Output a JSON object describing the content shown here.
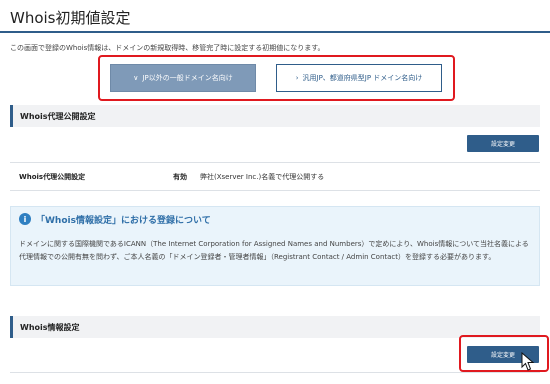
{
  "page": {
    "title": "Whois初期値設定"
  },
  "intro": "この画面で登録のWhois情報は、ドメインの新規取得時、移管完了時に設定する初期値になります。",
  "tabs": [
    {
      "label": "JP以外の一般ドメイン名向け",
      "active": true
    },
    {
      "label": "汎用JP、都道府県型JP ドメイン名向け",
      "active": false
    }
  ],
  "proxy_section": {
    "title": "Whois代理公開設定",
    "button": "設定変更",
    "row": {
      "label": "Whois代理公開設定",
      "status": "有効",
      "description": "弊社(Xserver Inc.)名義で代理公開する"
    }
  },
  "info": {
    "icon": "info-icon",
    "title": "「Whois情報設定」における登録について",
    "body": "ドメインに関する国際機関であるICANN（The Internet Corporation for Assigned Names and Numbers）で定めにより、Whois情報について当社名義による代理情報での公開有無を問わず、ご本人名義の「ドメイン登録者・管理者情報」（Registrant Contact / Admin Contact）を登録する必要があります。"
  },
  "whois_section": {
    "title": "Whois情報設定",
    "button": "設定変更"
  },
  "colors": {
    "accent": "#2f5d8a",
    "highlight": "#e0191f",
    "info_bg": "#eaf4fb"
  }
}
